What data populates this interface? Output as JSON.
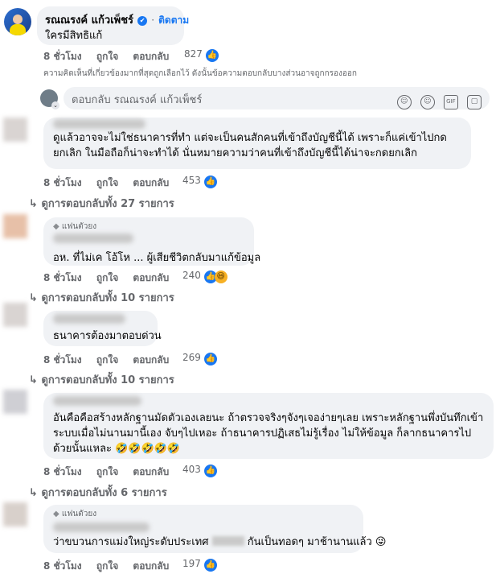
{
  "top_comment": {
    "author": "รณณรงค์ แก้วเพ็ชร์",
    "verified_mark": "✔",
    "follow": "ติดตาม",
    "text": "ใครมีสิทธิแก้",
    "time": "8 ชั่วโมง",
    "like": "ถูกใจ",
    "reply": "ตอบกลับ",
    "reactions": "827",
    "notice": "ความคิดเห็นที่เกี่ยวข้องมากที่สุดถูกเลือกไว้ ดังนั้นข้อความตอบกลับบางส่วนอาจถูกกรองออก",
    "reply_placeholder": "ตอบกลับ รณณรงค์ แก้วเพ็ชร์"
  },
  "comments": [
    {
      "text": "ดูแล้วอาจจะไม่ใช่ธนาคารที่ทำ แต่จะเป็นคนสักคนที่เข้าถึงบัญชีนี้ได้ เพราะก็แค่เข้าไปกดยกเลิก ในมือถือก็น่าจะทำได้ นั่นหมายความว่าคนที่เข้าถึงบัญชีนี้ได้น่าจะกดยกเลิก",
      "time": "8 ชั่วโมง",
      "like": "ถูกใจ",
      "reply": "ตอบกลับ",
      "reactions": "453",
      "replies": "ดูการตอบกลับทั้ง 27 รายการ"
    },
    {
      "badge": "แฟนตัวยง",
      "text": "อห. ที่ไม่เค โอ้โห ... ผู้เสียชีวิตกลับมาแก้ข้อมูล",
      "time": "8 ชั่วโมง",
      "like": "ถูกใจ",
      "reply": "ตอบกลับ",
      "reactions": "240",
      "replies": "ดูการตอบกลับทั้ง 10 รายการ"
    },
    {
      "text": "ธนาคารต้องมาตอบด่วน",
      "time": "8 ชั่วโมง",
      "like": "ถูกใจ",
      "reply": "ตอบกลับ",
      "reactions": "269",
      "replies": "ดูการตอบกลับทั้ง 10 รายการ"
    },
    {
      "text": "อันคือคือสร้างหลักฐานมัดตัวเองเลยนะ ถ้าตรวจจริงๆจังๆเจอง่ายๆเลย เพราะหลักฐานพึ่งบันทึกเข้าระบบเมื่อไม่นานมานี้เอง จับๆไปเหอะ ถ้าธนาคารปฏิเสธไม่รู้เรื่อง ไม่ให้ข้อมูล ก็ลากธนาคารไปด้วยนั้นแหละ 🤣🤣🤣🤣🤣",
      "time": "8 ชั่วโมง",
      "like": "ถูกใจ",
      "reply": "ตอบกลับ",
      "reactions": "403",
      "replies": "ดูการตอบกลับทั้ง 6 รายการ"
    },
    {
      "badge": "แฟนตัวยง",
      "text_a": "ว่าขบวนการแม่งใหญ่ระดับประเทศ",
      "text_b": "กันเป็นทอดๆ มาช้านานแล้ว 😜",
      "time": "8 ชั่วโมง",
      "like": "ถูกใจ",
      "reply": "ตอบกลับ",
      "reactions": "197"
    }
  ],
  "icons": {
    "like": "👍",
    "haha": "😆",
    "diamond": "◆",
    "sticker_icons": [
      "☺",
      "GIF",
      "▢"
    ]
  },
  "colors": {
    "link": "#1877f2",
    "bubble": "#f0f2f5",
    "muted": "#65676b"
  }
}
